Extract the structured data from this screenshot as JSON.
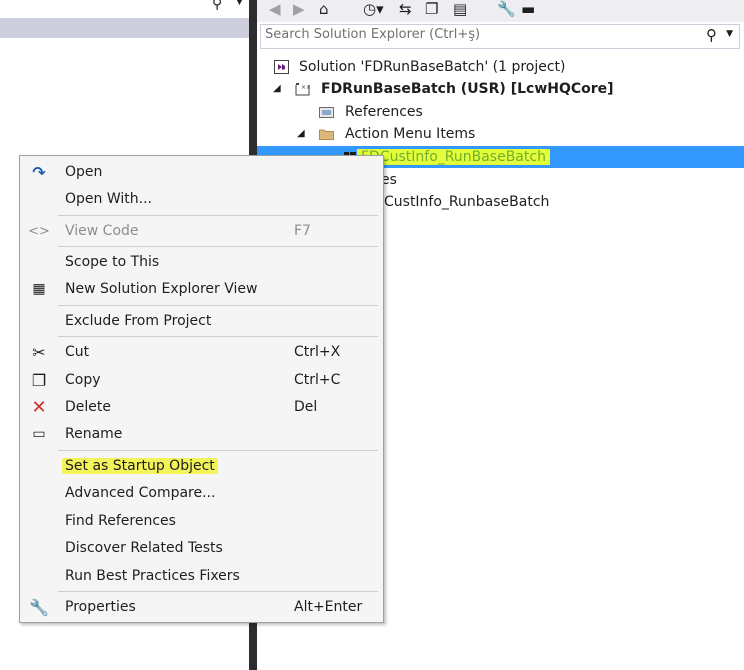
{
  "toolbar": {
    "icons": [
      "back-icon",
      "forward-icon",
      "home-icon",
      "history-icon",
      "sync-icon",
      "collapse-icon",
      "copy-view-icon",
      "properties-icon",
      "pin-icon"
    ]
  },
  "search": {
    "placeholder": "Search Solution Explorer (Ctrl+ş)"
  },
  "tree": {
    "solution": "Solution 'FDRunBaseBatch' (1 project)",
    "project": "FDRunBaseBatch (USR) [LcwHQCore]",
    "references": "References",
    "folder": "Action Menu Items",
    "selected_item": "FDCustInfo_RunBaseBatch",
    "item_partial_1": "es",
    "item_partial_2": "CustInfo_RunbaseBatch"
  },
  "menu": {
    "items": [
      {
        "label": "Open",
        "shortcut": ""
      },
      {
        "label": "Open With...",
        "shortcut": ""
      },
      {
        "label": "View Code",
        "shortcut": "F7"
      },
      {
        "label": "Scope to This",
        "shortcut": ""
      },
      {
        "label": "New Solution Explorer View",
        "shortcut": ""
      },
      {
        "label": "Exclude From Project",
        "shortcut": ""
      },
      {
        "label": "Cut",
        "shortcut": "Ctrl+X"
      },
      {
        "label": "Copy",
        "shortcut": "Ctrl+C"
      },
      {
        "label": "Delete",
        "shortcut": "Del"
      },
      {
        "label": "Rename",
        "shortcut": ""
      },
      {
        "label": "Set as Startup Object",
        "shortcut": ""
      },
      {
        "label": "Advanced Compare...",
        "shortcut": ""
      },
      {
        "label": "Find References",
        "shortcut": ""
      },
      {
        "label": "Discover Related Tests",
        "shortcut": ""
      },
      {
        "label": "Run Best Practices Fixers",
        "shortcut": ""
      },
      {
        "label": "Properties",
        "shortcut": "Alt+Enter"
      }
    ]
  },
  "colors": {
    "selection": "#3399ff",
    "highlight_yellow": "#f3f35a",
    "highlight_green_text": "#6fae2e",
    "delete_icon": "#d0312d",
    "open_icon": "#1e5fa8",
    "vs_project_icon": "#68217a"
  }
}
